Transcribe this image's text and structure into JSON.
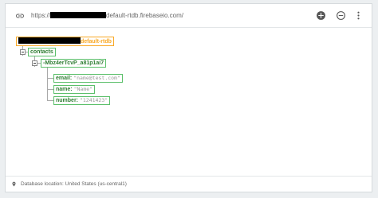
{
  "header": {
    "url_prefix": "https://",
    "url_suffix": "default-rtdb.firebaseio.com/",
    "link_icon": "link-icon",
    "add_icon": "add-circle-icon",
    "remove_icon": "remove-circle-icon",
    "more_icon": "more-vert-icon"
  },
  "tree": {
    "root": {
      "label_suffix": "default-rtdb"
    },
    "contacts": {
      "key": "contacts"
    },
    "entry": {
      "key": "-Mbz4erTcvP_a81p1ai7"
    },
    "fields": [
      {
        "key": "email:",
        "value": "\"name@test.com\""
      },
      {
        "key": "name:",
        "value": "\"Name\""
      },
      {
        "key": "number:",
        "value": "\"1241423\""
      }
    ]
  },
  "footer": {
    "text": "Database location: United States (us-central1)",
    "icon": "location-pin-icon"
  },
  "colors": {
    "root": "#f9a825",
    "node": "#5cc06b",
    "background": "#eceff1"
  }
}
